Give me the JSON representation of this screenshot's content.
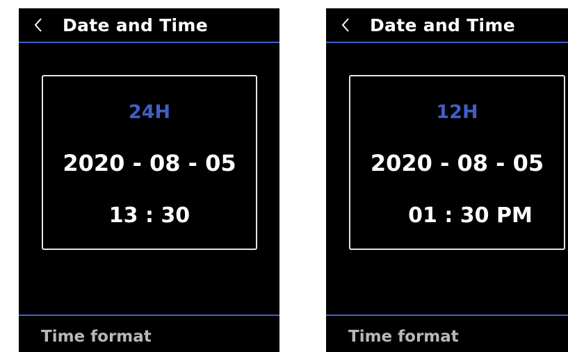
{
  "colors": {
    "background": "#000000",
    "accent": "#3f63c9",
    "format_text": "#3f5fc4",
    "text": "#ffffff",
    "muted_text": "#b8b8b8"
  },
  "screens": [
    {
      "header": {
        "back_icon": "chevron-left-icon",
        "title": "Date and Time"
      },
      "clock": {
        "format": "24H",
        "date": "2020 - 08 - 05",
        "time": "13 : 30"
      },
      "footer": {
        "label": "Time format"
      }
    },
    {
      "header": {
        "back_icon": "chevron-left-icon",
        "title": "Date and Time"
      },
      "clock": {
        "format": "12H",
        "date": "2020 - 08 - 05",
        "time": "01 : 30 PM"
      },
      "footer": {
        "label": "Time format"
      }
    }
  ]
}
